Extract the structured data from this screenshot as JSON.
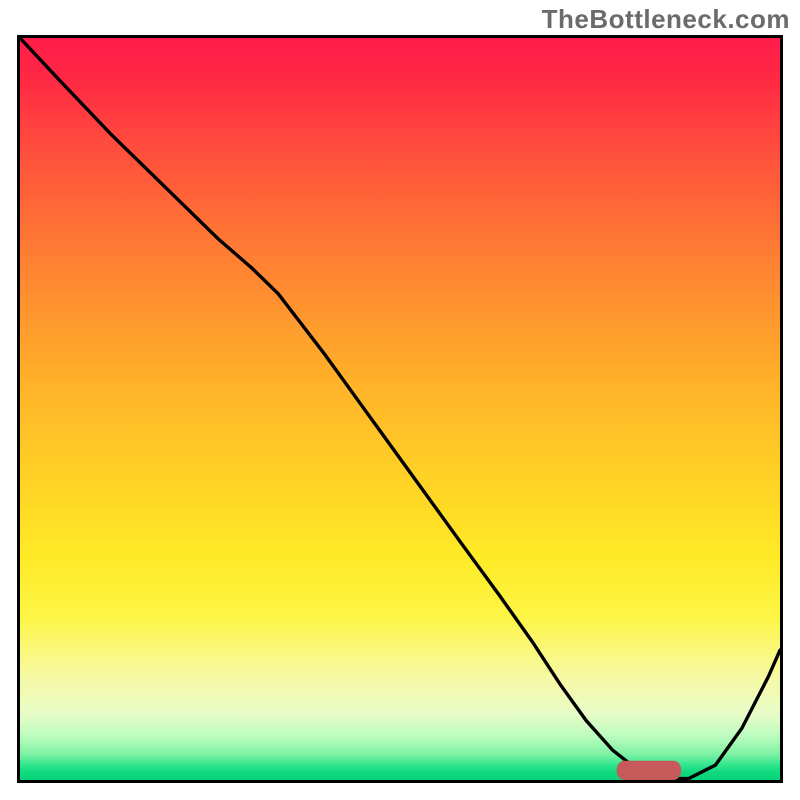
{
  "watermark": "TheBottleneck.com",
  "chart_data": {
    "type": "line",
    "title": "",
    "xlabel": "",
    "ylabel": "",
    "xlim": [
      0,
      100
    ],
    "ylim": [
      0,
      100
    ],
    "background_gradient_stops": [
      {
        "pos": 0,
        "color": "#ff1c4b"
      },
      {
        "pos": 6,
        "color": "#ff2a43"
      },
      {
        "pos": 14,
        "color": "#ff4a3e"
      },
      {
        "pos": 24,
        "color": "#ff6d36"
      },
      {
        "pos": 36,
        "color": "#ff932f"
      },
      {
        "pos": 48,
        "color": "#ffb629"
      },
      {
        "pos": 60,
        "color": "#ffd325"
      },
      {
        "pos": 70,
        "color": "#ffea26"
      },
      {
        "pos": 78,
        "color": "#fdf546"
      },
      {
        "pos": 86,
        "color": "#f7f9a3"
      },
      {
        "pos": 91,
        "color": "#e9fcc8"
      },
      {
        "pos": 94,
        "color": "#bdfcc0"
      },
      {
        "pos": 96.5,
        "color": "#7ff2a4"
      },
      {
        "pos": 98,
        "color": "#2fe58d"
      },
      {
        "pos": 99,
        "color": "#0fd97f"
      },
      {
        "pos": 100,
        "color": "#0ad17a"
      }
    ],
    "series": [
      {
        "name": "bottleneck-curve",
        "color": "#000000",
        "x": [
          0.0,
          5.2,
          12.0,
          19.5,
          26.0,
          30.5,
          34.0,
          40.0,
          46.0,
          52.0,
          58.0,
          63.0,
          67.5,
          71.0,
          74.5,
          78.0,
          81.5,
          85.0,
          88.0,
          91.5,
          95.0,
          98.5,
          100.0
        ],
        "y": [
          100.0,
          94.3,
          87.0,
          79.5,
          73.0,
          69.0,
          65.5,
          57.5,
          49.0,
          40.5,
          32.0,
          25.0,
          18.5,
          13.0,
          8.0,
          4.0,
          1.2,
          0.2,
          0.2,
          2.0,
          7.0,
          14.0,
          17.5
        ]
      }
    ],
    "marker": {
      "name": "optimal-range-marker",
      "shape": "rounded-bar",
      "color": "#c65a5a",
      "x_start": 78.5,
      "x_end": 87.0,
      "y": 1.3,
      "thickness": 2.6
    }
  }
}
